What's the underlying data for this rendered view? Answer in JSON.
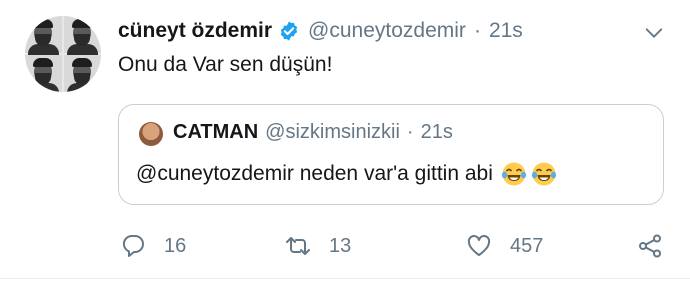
{
  "tweet": {
    "author_name": "cüneyt özdemir",
    "author_handle": "@cuneytozdemir",
    "separator": "·",
    "time": "21s",
    "verified": true,
    "text": "Onu da Var sen düşün!",
    "menu_icon": "chevron-down-icon"
  },
  "quoted_tweet": {
    "author_name": "CATMAN",
    "author_handle": "@sizkimsinizkii",
    "separator": "·",
    "time": "21s",
    "text": "@cuneytozdemir neden var'a gittin abi",
    "emojis": [
      "face-with-tears-of-joy",
      "face-with-tears-of-joy"
    ]
  },
  "actions": {
    "reply_count": "16",
    "retweet_count": "13",
    "like_count": "457",
    "share_icon": "share-icon"
  },
  "colors": {
    "text": "#14171a",
    "secondary": "#657786",
    "verified": "#1da1f2",
    "border": "#c7d0d8"
  }
}
